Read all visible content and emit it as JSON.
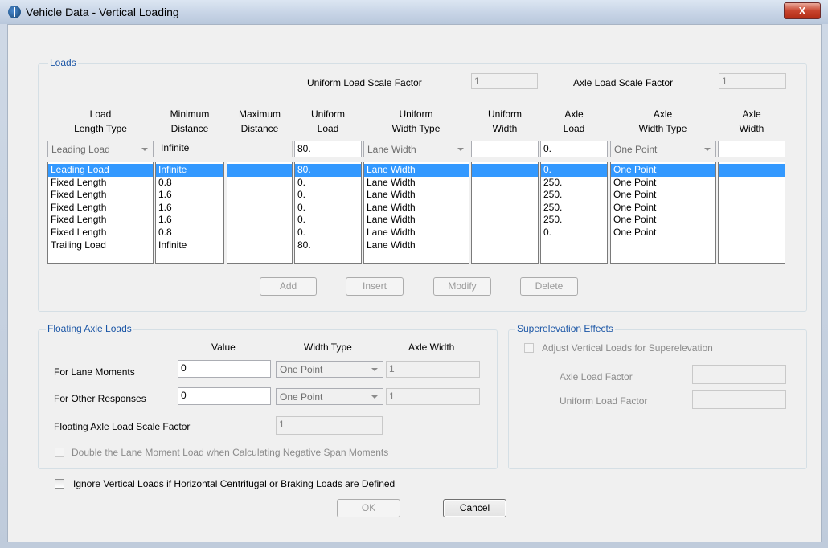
{
  "window": {
    "title": "Vehicle Data - Vertical Loading",
    "close_glyph": "X"
  },
  "loads": {
    "legend": "Loads",
    "uniform_scale_label": "Uniform Load Scale Factor",
    "uniform_scale_value": "1",
    "axle_scale_label": "Axle Load Scale Factor",
    "axle_scale_value": "1",
    "headers": [
      [
        "Load",
        "Length Type"
      ],
      [
        "Minimum",
        "Distance"
      ],
      [
        "Maximum",
        "Distance"
      ],
      [
        "Uniform",
        "Load"
      ],
      [
        "Uniform",
        "Width Type"
      ],
      [
        "Uniform",
        "Width"
      ],
      [
        "Axle",
        "Load"
      ],
      [
        "Axle",
        "Width Type"
      ],
      [
        "Axle",
        "Width"
      ]
    ],
    "edit_row": {
      "load_length_type": "Leading Load",
      "min_distance": "Infinite",
      "max_distance": "",
      "uniform_load": "80.",
      "uniform_width_type": "Lane Width",
      "uniform_width": "",
      "axle_load": "0.",
      "axle_width_type": "One Point",
      "axle_width": ""
    },
    "columns": {
      "load_length_type": [
        "Leading Load",
        "Fixed Length",
        "Fixed Length",
        "Fixed Length",
        "Fixed Length",
        "Fixed Length",
        "Trailing Load"
      ],
      "min_distance": [
        "Infinite",
        "0.8",
        "1.6",
        "1.6",
        "1.6",
        "0.8",
        "Infinite"
      ],
      "max_distance": [],
      "uniform_load": [
        "80.",
        "0.",
        "0.",
        "0.",
        "0.",
        "0.",
        "80."
      ],
      "uniform_width_type": [
        "Lane Width",
        "Lane Width",
        "Lane Width",
        "Lane Width",
        "Lane Width",
        "Lane Width",
        "Lane Width"
      ],
      "uniform_width": [],
      "axle_load": [
        "0.",
        "250.",
        "250.",
        "250.",
        "250.",
        "0."
      ],
      "axle_width_type": [
        "One Point",
        "One Point",
        "One Point",
        "One Point",
        "One Point",
        "One Point"
      ],
      "axle_width": []
    },
    "buttons": {
      "add": "Add",
      "insert": "Insert",
      "modify": "Modify",
      "delete": "Delete"
    }
  },
  "floating": {
    "legend": "Floating Axle Loads",
    "col_value": "Value",
    "col_width_type": "Width Type",
    "col_axle_width": "Axle Width",
    "lane_moments_label": "For Lane Moments",
    "lane_moments_value": "0",
    "lane_moments_width_type": "One Point",
    "lane_moments_axle_width": "1",
    "other_label": "For Other Responses",
    "other_value": "0",
    "other_width_type": "One Point",
    "other_axle_width": "1",
    "scale_label": "Floating Axle Load Scale Factor",
    "scale_value": "1",
    "double_label": "Double the Lane Moment Load when Calculating Negative Span Moments"
  },
  "superelevation": {
    "legend": "Superelevation Effects",
    "adjust_label": "Adjust Vertical Loads for Superelevation",
    "axle_factor_label": "Axle Load Factor",
    "axle_factor_value": "",
    "uniform_factor_label": "Uniform Load Factor",
    "uniform_factor_value": ""
  },
  "ignore_label": "Ignore Vertical Loads if Horizontal Centrifugal or Braking Loads are Defined",
  "ok_label": "OK",
  "cancel_label": "Cancel"
}
